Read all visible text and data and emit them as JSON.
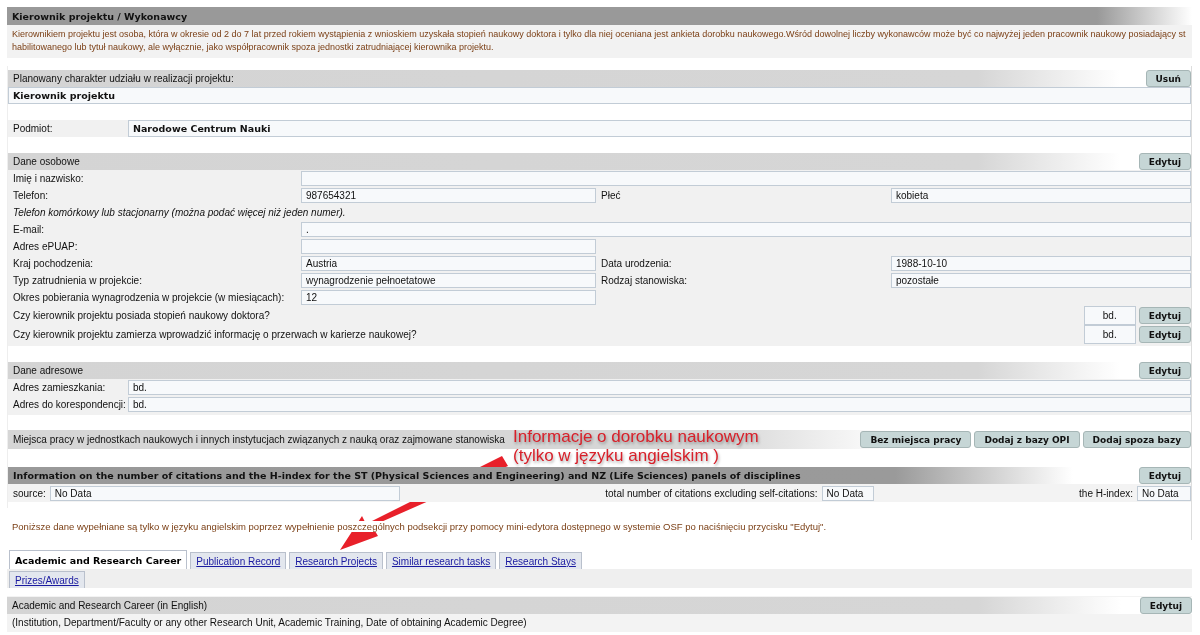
{
  "title": "Kierownik projektu / Wykonawcy",
  "notice_lines": [
    "Kierownikiem projektu jest osoba, która w okresie od 2 do 7 lat przed rokiem wystąpienia z wnioskiem uzyskała stopień naukowy doktora i tylko dla niej oceniana jest ankieta dorobku naukowego.Wśród dowolnej liczby wykonawców może być co najwyżej jeden pracownik naukowy posiadający st",
    "habilitowanego lub tytuł naukowy, ale wyłącznie, jako współpracownik spoza jednostki zatrudniającej kierownika projektu."
  ],
  "participation": {
    "label": "Planowany charakter udziału w realizacji projektu:",
    "button": "Usuń",
    "value": "Kierownik projektu"
  },
  "entity": {
    "label": "Podmiot:",
    "value": "Narodowe Centrum Nauki"
  },
  "personal": {
    "title": "Dane osobowe",
    "button": "Edytuj",
    "rows": [
      {
        "kind": "wide",
        "label": "Imię i nazwisko:"
      },
      {
        "kind": "pair",
        "label": "Telefon:",
        "value": "987654321",
        "label2": "Płeć",
        "value2": "kobieta"
      },
      {
        "kind": "hint",
        "text": "Telefon komórkowy lub stacjonarny (można podać więcej niż jeden numer)."
      },
      {
        "kind": "wide",
        "label": "E-mail:",
        "value": "."
      },
      {
        "kind": "half",
        "label": "Adres ePUAP:"
      },
      {
        "kind": "pair",
        "label": "Kraj pochodzenia:",
        "value": "Austria",
        "label2": "Data urodzenia:",
        "value2": "1988-10-10"
      },
      {
        "kind": "pair",
        "label": "Typ zatrudnienia w projekcie:",
        "value": "wynagrodzenie pełnoetatowe",
        "label2": "Rodzaj stanowiska:",
        "value2": "pozostałe"
      },
      {
        "kind": "half",
        "label": "Okres pobierania wynagrodzenia w projekcie (w miesiącach):",
        "value": "12"
      },
      {
        "kind": "question",
        "label": "Czy kierownik projektu posiada stopień naukowy doktora?",
        "value": "bd.",
        "button": "Edytuj"
      },
      {
        "kind": "question",
        "label": "Czy kierownik projektu zamierza wprowadzić informację o przerwach w karierze naukowej?",
        "value": "bd.",
        "button": "Edytuj"
      }
    ]
  },
  "address": {
    "title": "Dane adresowe",
    "button": "Edytuj",
    "rows": [
      {
        "label": "Adres zamieszkania:",
        "value": "bd."
      },
      {
        "label": "Adres do korespondencji:",
        "value": "bd."
      }
    ]
  },
  "workplaces": {
    "label": "Miejsca pracy w jednostkach naukowych i innych instytucjach związanych z nauką oraz zajmowane stanowiska",
    "buttons": [
      "Bez miejsca pracy",
      "Dodaj z bazy OPI",
      "Dodaj spoza bazy"
    ]
  },
  "citations": {
    "title": "Information on the number of citations and the H-index for the ST (Physical Sciences and Engineering) and NZ (Life Sciences) panels of disciplines",
    "button": "Edytuj",
    "source_label": "source:",
    "source_value": "No Data",
    "total_label": "total number of citations excluding self-citations:",
    "total_value": "No Data",
    "h_label": "the H-index:",
    "h_value": "No Data"
  },
  "note": "Poniższe dane wypełniane są tylko w języku angielskim poprzez wypełnienie poszczególnych podsekcji przy pomocy mini-edytora dostępnego w systemie OSF po naciśnięciu przycisku \"Edytuj\".",
  "tab_rows": [
    [
      {
        "label": "Academic and Research Career",
        "selected": true
      },
      {
        "label": "Publication Record",
        "selected": false
      },
      {
        "label": "Research Projects",
        "selected": false
      },
      {
        "label": "Similar research tasks",
        "selected": false
      },
      {
        "label": "Research Stays",
        "selected": false
      }
    ],
    [
      {
        "label": "Prizes/Awards",
        "selected": false
      }
    ]
  ],
  "career": {
    "title": "Academic and Research Career (in English)",
    "button": "Edytuj",
    "description": "(Institution, Department/Faculty or any other Research Unit, Academic Training, Date of obtaining Academic Degree)"
  },
  "annotation": {
    "lines": [
      "Informacje o dorobku naukowym",
      "(tylko w języku angielskim )"
    ]
  }
}
